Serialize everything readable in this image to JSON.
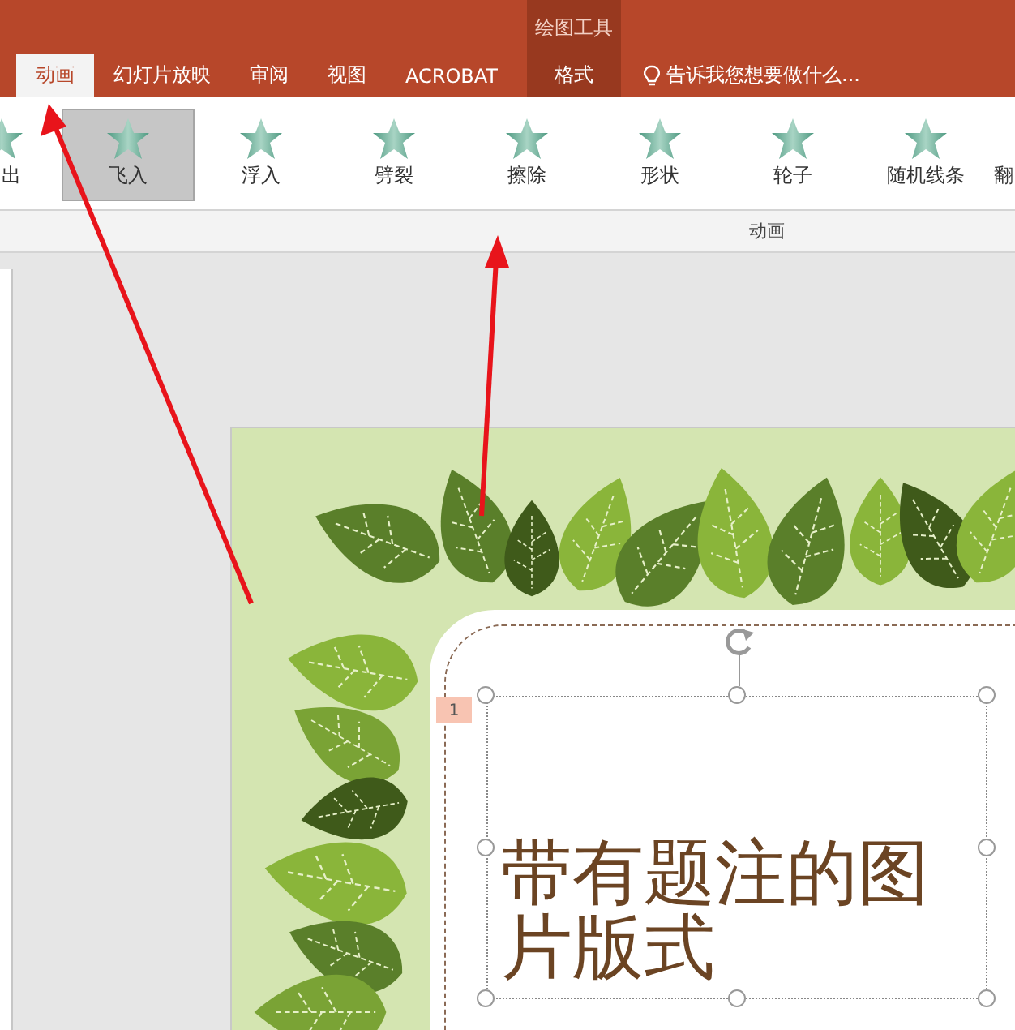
{
  "context_group": {
    "title": "绘图工具"
  },
  "tabs": [
    {
      "label": "动画",
      "selected": true,
      "kind": "normal"
    },
    {
      "label": "幻灯片放映",
      "selected": false,
      "kind": "normal"
    },
    {
      "label": "审阅",
      "selected": false,
      "kind": "normal"
    },
    {
      "label": "视图",
      "selected": false,
      "kind": "normal"
    },
    {
      "label": "ACROBAT",
      "selected": false,
      "kind": "normal"
    },
    {
      "label": "格式",
      "selected": false,
      "kind": "contextual"
    }
  ],
  "tell_me": {
    "placeholder": "告诉我您想要做什么..."
  },
  "animations": [
    {
      "label": "出",
      "selected": false
    },
    {
      "label": "飞入",
      "selected": true
    },
    {
      "label": "浮入",
      "selected": false
    },
    {
      "label": "劈裂",
      "selected": false
    },
    {
      "label": "擦除",
      "selected": false
    },
    {
      "label": "形状",
      "selected": false
    },
    {
      "label": "轮子",
      "selected": false
    },
    {
      "label": "随机线条",
      "selected": false
    },
    {
      "label": "翻",
      "selected": false
    }
  ],
  "ribbon_group": {
    "label": "动画"
  },
  "slide": {
    "animation_tag": "1",
    "title": "带有题注的图片版式"
  }
}
